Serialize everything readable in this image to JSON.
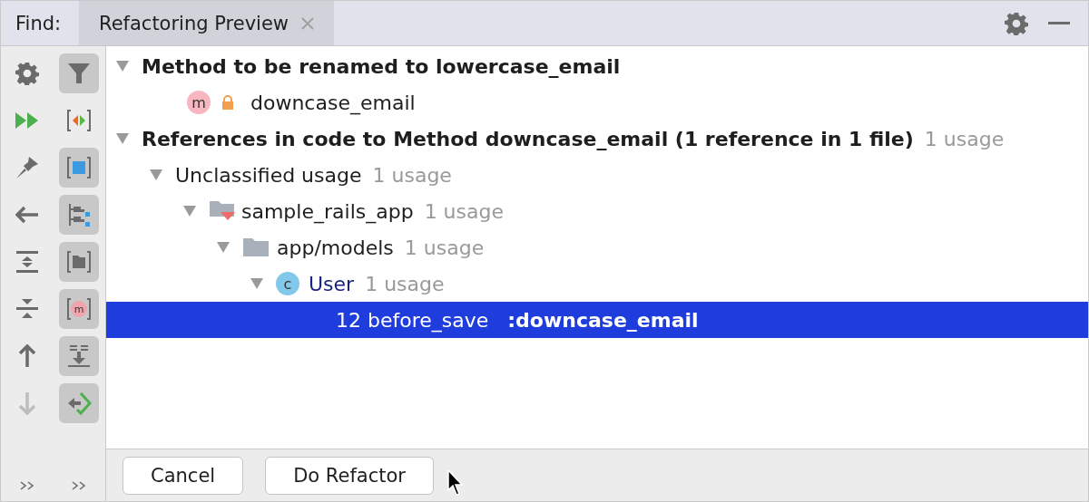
{
  "find_bar": {
    "label": "Find:",
    "tabs": [
      {
        "label": "Refactoring Preview",
        "selected": true
      }
    ]
  },
  "toolbar_left": [
    {
      "kind": "settings",
      "disabled": false
    },
    {
      "kind": "rerun",
      "disabled": false
    },
    {
      "kind": "pin",
      "disabled": false
    },
    {
      "kind": "back",
      "disabled": false
    },
    {
      "kind": "expand",
      "disabled": false
    },
    {
      "kind": "collapse",
      "disabled": false
    },
    {
      "kind": "up",
      "disabled": false
    },
    {
      "kind": "down",
      "disabled": true
    }
  ],
  "toolbar_right": [
    {
      "kind": "filter",
      "on": true
    },
    {
      "kind": "diff",
      "on": false
    },
    {
      "kind": "scope",
      "on": true
    },
    {
      "kind": "group-module",
      "on": true
    },
    {
      "kind": "group-dir",
      "on": true
    },
    {
      "kind": "group-method",
      "on": true,
      "badge": "m"
    },
    {
      "kind": "merge",
      "on": true
    },
    {
      "kind": "export",
      "on": true
    }
  ],
  "tree": [
    {
      "kind": "group",
      "label": "Method to be renamed to lowercase_email",
      "expanded": true,
      "selected": false,
      "children": [
        {
          "kind": "method",
          "badge": "m",
          "label": "downcase_email",
          "selected": false
        }
      ]
    },
    {
      "kind": "group",
      "label": "References in code to Method downcase_email (1 reference in 1 file)",
      "count": "1 usage",
      "expanded": true,
      "selected": false,
      "children": [
        {
          "kind": "category",
          "label": "Unclassified usage",
          "count": "1 usage",
          "expanded": true,
          "selected": false,
          "children": [
            {
              "kind": "module",
              "label": "sample_rails_app",
              "count": "1 usage",
              "expanded": true,
              "selected": false,
              "children": [
                {
                  "kind": "folder",
                  "label": "app/models",
                  "count": "1 usage",
                  "expanded": true,
                  "selected": false,
                  "children": [
                    {
                      "kind": "class",
                      "badge": "c",
                      "label": "User",
                      "count": "1 usage",
                      "expanded": true,
                      "selected": false,
                      "children": [
                        {
                          "kind": "line",
                          "label": "12 before_save   **:downcase_email**",
                          "selected": true
                        }
                      ]
                    }
                  ]
                }
              ]
            }
          ]
        }
      ]
    }
  ],
  "buttons": [
    {
      "label": "Cancel"
    },
    {
      "label": "Do Refactor"
    }
  ]
}
